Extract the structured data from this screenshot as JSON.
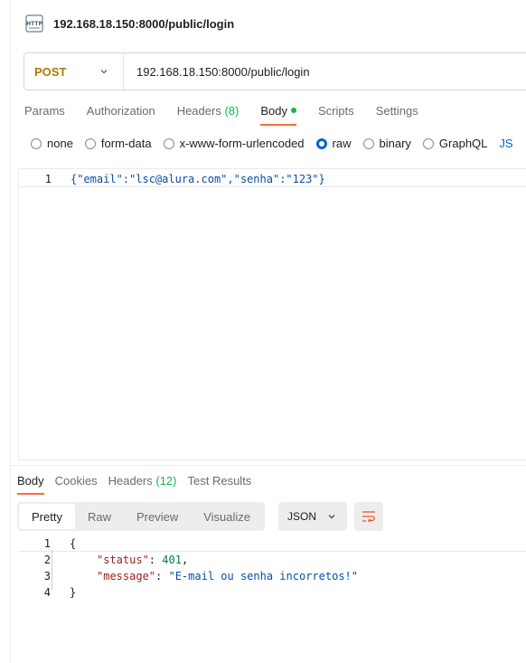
{
  "request": {
    "title": "192.168.18.150:8000/public/login",
    "method": "POST",
    "url": "192.168.18.150:8000/public/login"
  },
  "request_tabs": [
    {
      "label": "Params"
    },
    {
      "label": "Authorization"
    },
    {
      "label": "Headers",
      "count": "(8)"
    },
    {
      "label": "Body",
      "active": true
    },
    {
      "label": "Scripts"
    },
    {
      "label": "Settings"
    }
  ],
  "body_modes": [
    {
      "label": "none"
    },
    {
      "label": "form-data"
    },
    {
      "label": "x-www-form-urlencoded"
    },
    {
      "label": "raw",
      "checked": true
    },
    {
      "label": "binary"
    },
    {
      "label": "GraphQL"
    }
  ],
  "body_type_label": "JS",
  "editor": {
    "line_number": "1",
    "code": "{\"email\":\"lsc@alura.com\",\"senha\":\"123\"}"
  },
  "response_tabs": [
    {
      "label": "Body",
      "active": true
    },
    {
      "label": "Cookies"
    },
    {
      "label": "Headers",
      "count": "(12)"
    },
    {
      "label": "Test Results"
    }
  ],
  "view_modes": [
    {
      "label": "Pretty",
      "active": true
    },
    {
      "label": "Raw"
    },
    {
      "label": "Preview"
    },
    {
      "label": "Visualize"
    }
  ],
  "format_select": "JSON",
  "response": {
    "lines": [
      {
        "n": "1",
        "text": "{"
      },
      {
        "n": "2",
        "key": "\"status\"",
        "value": "401",
        "value_type": "number",
        "trail": ","
      },
      {
        "n": "3",
        "key": "\"message\"",
        "value": "\"E-mail ou senha incorretos!\"",
        "value_type": "string",
        "trail": ""
      },
      {
        "n": "4",
        "text": "}"
      }
    ]
  },
  "colors": {
    "accent": "#ff6c37",
    "method": "#ad7a03",
    "radio_checked": "#0265d2",
    "count_green": "#0cbb52"
  },
  "icons": [
    "http-icon",
    "chevron-down-icon",
    "wrap-lines-icon"
  ]
}
